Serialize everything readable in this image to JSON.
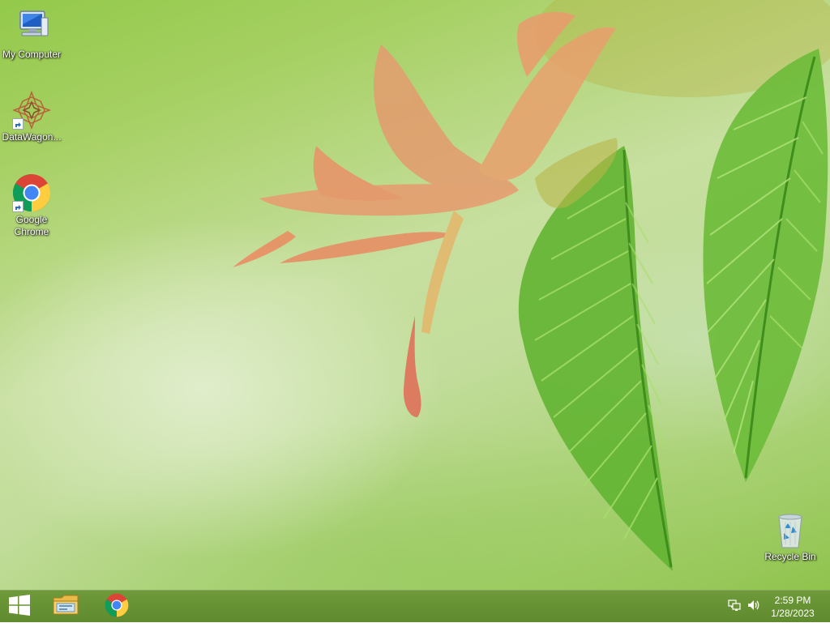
{
  "desktop": {
    "icons": [
      {
        "label": "My Computer",
        "icon": "computer-icon"
      },
      {
        "label": "DataWagon...",
        "icon": "datawagon-icon"
      },
      {
        "label": "Google Chrome",
        "icon": "chrome-icon"
      },
      {
        "label": "Recycle Bin",
        "icon": "recycle-bin-icon"
      }
    ]
  },
  "taskbar": {
    "start_icon": "windows-logo-icon",
    "pinned": [
      {
        "icon": "file-explorer-icon"
      },
      {
        "icon": "chrome-icon"
      }
    ],
    "tray": {
      "network_icon": "network-icon",
      "volume_icon": "volume-icon",
      "time": "2:59 PM",
      "date": "1/28/2023"
    }
  },
  "colors": {
    "taskbar": "#6a9535",
    "wallpaper_primary": "#a6d063",
    "flower": "#e8a070",
    "leaf": "#6fbb3a"
  }
}
